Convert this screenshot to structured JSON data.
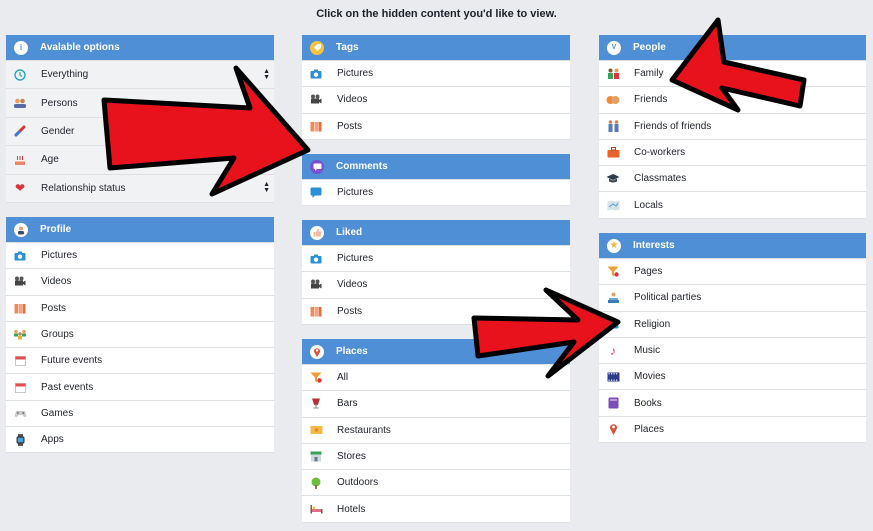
{
  "heading": "Click on the hidden content you'd like to view.",
  "colors": {
    "header_bg": "#4f8fd6",
    "arrow_fill": "#e8121c",
    "arrow_stroke": "#000000"
  },
  "available_options": {
    "title": "Avalable options",
    "icon": "info-icon",
    "items": [
      {
        "label": "Everything",
        "icon": "clock-icon",
        "has_stepper": true
      },
      {
        "label": "Persons",
        "icon": "people-icon"
      },
      {
        "label": "Gender",
        "icon": "gender-icon"
      },
      {
        "label": "Age",
        "icon": "cake-icon"
      },
      {
        "label": "Relationship status",
        "icon": "heart-icon",
        "has_stepper": true
      }
    ]
  },
  "profile": {
    "title": "Profile",
    "icon": "user-icon",
    "items": [
      {
        "label": "Pictures",
        "icon": "camera-icon"
      },
      {
        "label": "Videos",
        "icon": "film-camera-icon"
      },
      {
        "label": "Posts",
        "icon": "posts-icon"
      },
      {
        "label": "Groups",
        "icon": "groups-icon"
      },
      {
        "label": "Future events",
        "icon": "calendar-icon"
      },
      {
        "label": "Past events",
        "icon": "calendar-icon"
      },
      {
        "label": "Games",
        "icon": "gamepad-icon"
      },
      {
        "label": "Apps",
        "icon": "watch-icon"
      }
    ]
  },
  "tags": {
    "title": "Tags",
    "icon": "tag-icon",
    "items": [
      {
        "label": "Pictures",
        "icon": "camera-icon"
      },
      {
        "label": "Videos",
        "icon": "film-camera-icon"
      },
      {
        "label": "Posts",
        "icon": "posts-icon"
      }
    ]
  },
  "comments": {
    "title": "Comments",
    "icon": "comment-icon",
    "items": [
      {
        "label": "Pictures",
        "icon": "speech-bubble-icon"
      }
    ]
  },
  "liked": {
    "title": "Liked",
    "icon": "like-icon",
    "items": [
      {
        "label": "Pictures",
        "icon": "camera-icon"
      },
      {
        "label": "Videos",
        "icon": "film-camera-icon"
      },
      {
        "label": "Posts",
        "icon": "posts-icon"
      }
    ]
  },
  "places": {
    "title": "Places",
    "icon": "map-pin-icon",
    "items": [
      {
        "label": "All",
        "icon": "funnel-icon"
      },
      {
        "label": "Bars",
        "icon": "wine-glass-icon"
      },
      {
        "label": "Restaurants",
        "icon": "ticket-icon"
      },
      {
        "label": "Stores",
        "icon": "store-icon"
      },
      {
        "label": "Outdoors",
        "icon": "tree-icon"
      },
      {
        "label": "Hotels",
        "icon": "bed-icon"
      }
    ]
  },
  "people": {
    "title": "People",
    "icon": "badge-icon",
    "items": [
      {
        "label": "Family",
        "icon": "family-icon"
      },
      {
        "label": "Friends",
        "icon": "friends-icon"
      },
      {
        "label": "Friends of friends",
        "icon": "friends-of-friends-icon"
      },
      {
        "label": "Co-workers",
        "icon": "briefcase-icon"
      },
      {
        "label": "Classmates",
        "icon": "graduation-cap-icon"
      },
      {
        "label": "Locals",
        "icon": "map-icon"
      }
    ]
  },
  "interests": {
    "title": "Interests",
    "icon": "star-icon",
    "items": [
      {
        "label": "Pages",
        "icon": "funnel-icon"
      },
      {
        "label": "Political parties",
        "icon": "speech-person-icon"
      },
      {
        "label": "Religion",
        "icon": "camera-icon"
      },
      {
        "label": "Music",
        "icon": "music-note-icon"
      },
      {
        "label": "Movies",
        "icon": "film-strip-icon"
      },
      {
        "label": "Books",
        "icon": "book-icon"
      },
      {
        "label": "Places",
        "icon": "map-pin-icon"
      }
    ]
  }
}
